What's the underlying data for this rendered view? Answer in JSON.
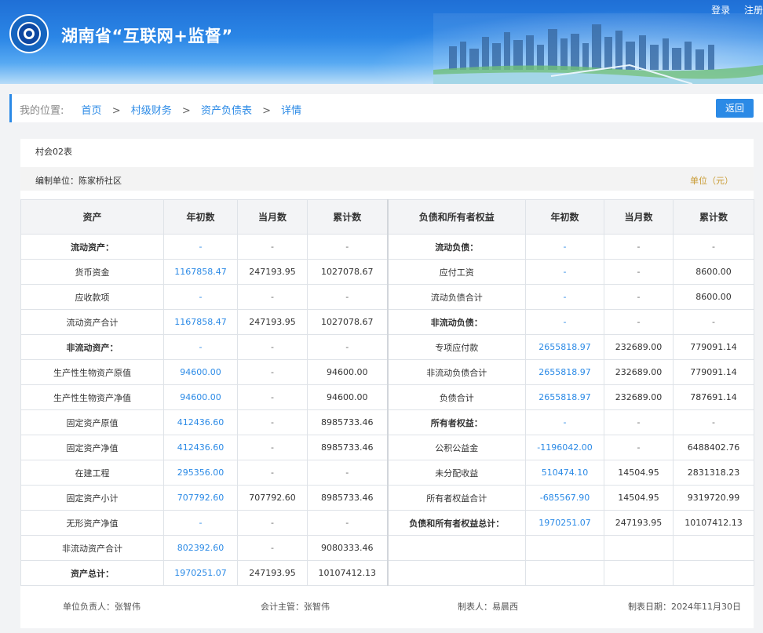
{
  "header": {
    "title": "湖南省“互联网+监督”",
    "login": "登录",
    "register": "注册"
  },
  "breadcrumb": {
    "prefix": "我的位置:",
    "items": [
      "首页",
      "村级财务",
      "资产负债表",
      "详情"
    ],
    "back": "返回"
  },
  "sheet": {
    "form_no": "村会02表",
    "unit_name": "编制单位：陈家桥社区",
    "unit": "单位（元）",
    "headers": [
      "资产",
      "年初数",
      "当月数",
      "累计数",
      "负债和所有者权益",
      "年初数",
      "当月数",
      "累计数"
    ],
    "rows": [
      [
        "流动资产：",
        "-",
        "-",
        "-",
        "流动负债：",
        "-",
        "-",
        "-"
      ],
      [
        "货币资金",
        "1167858.47",
        "247193.95",
        "1027078.67",
        "应付工资",
        "-",
        "-",
        "8600.00"
      ],
      [
        "应收款项",
        "-",
        "-",
        "-",
        "流动负债合计",
        "-",
        "-",
        "8600.00"
      ],
      [
        "流动资产合计",
        "1167858.47",
        "247193.95",
        "1027078.67",
        "非流动负债：",
        "-",
        "-",
        "-"
      ],
      [
        "非流动资产：",
        "-",
        "-",
        "-",
        "专项应付款",
        "2655818.97",
        "232689.00",
        "779091.14"
      ],
      [
        "生产性生物资产原值",
        "94600.00",
        "-",
        "94600.00",
        "非流动负债合计",
        "2655818.97",
        "232689.00",
        "779091.14"
      ],
      [
        "生产性生物资产净值",
        "94600.00",
        "-",
        "94600.00",
        "负债合计",
        "2655818.97",
        "232689.00",
        "787691.14"
      ],
      [
        "固定资产原值",
        "412436.60",
        "-",
        "8985733.46",
        "所有者权益：",
        "-",
        "-",
        "-"
      ],
      [
        "固定资产净值",
        "412436.60",
        "-",
        "8985733.46",
        "公积公益金",
        "-1196042.00",
        "-",
        "6488402.76"
      ],
      [
        "在建工程",
        "295356.00",
        "-",
        "-",
        "未分配收益",
        "510474.10",
        "14504.95",
        "2831318.23"
      ],
      [
        "固定资产小计",
        "707792.60",
        "707792.60",
        "8985733.46",
        "所有者权益合计",
        "-685567.90",
        "14504.95",
        "9319720.99"
      ],
      [
        "无形资产净值",
        "-",
        "-",
        "-",
        "负债和所有者权益总计：",
        "1970251.07",
        "247193.95",
        "10107412.13"
      ],
      [
        "非流动资产合计",
        "802392.60",
        "-",
        "9080333.46",
        "",
        "",
        "",
        ""
      ],
      [
        "资产总计：",
        "1970251.07",
        "247193.95",
        "10107412.13",
        "",
        "",
        "",
        ""
      ]
    ]
  },
  "signatures": {
    "owner": "单位负责人：张智伟",
    "accountant": "会计主管：张智伟",
    "preparer": "制表人：易晨西",
    "date": "制表日期：2024年11月30日"
  }
}
